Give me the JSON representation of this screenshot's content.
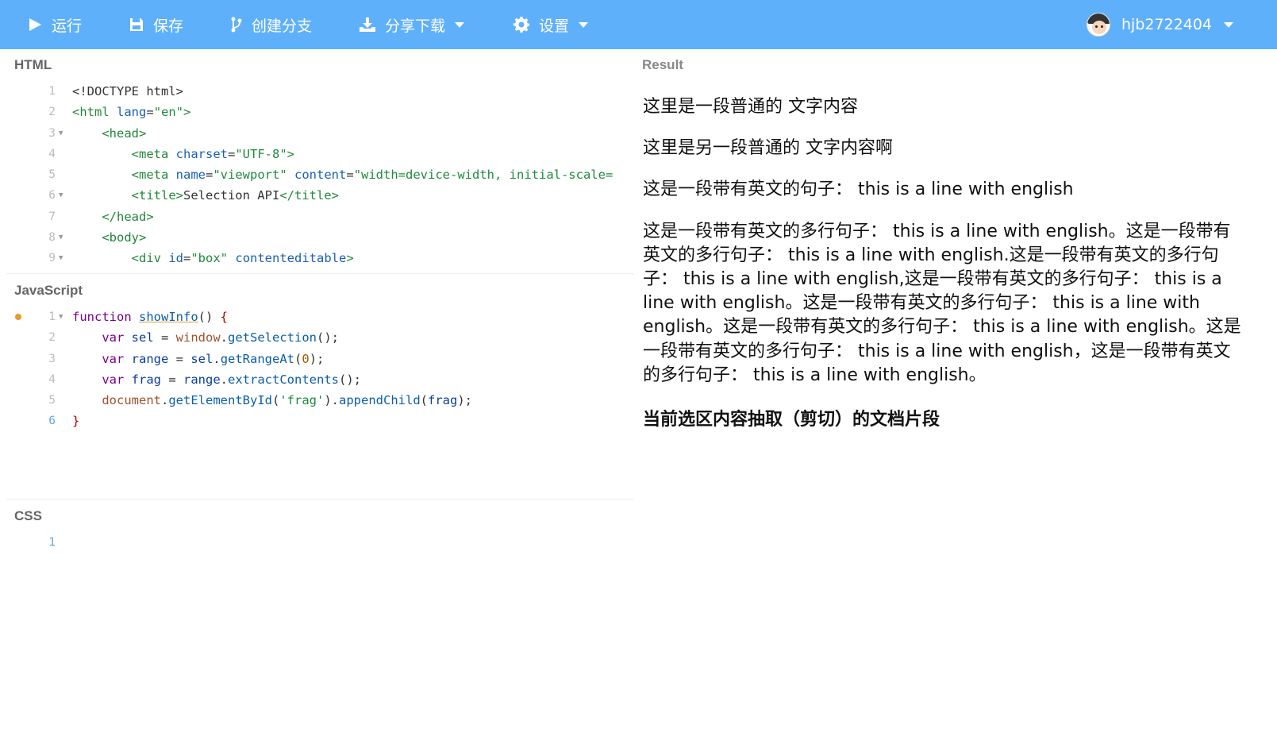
{
  "toolbar": {
    "run": "运行",
    "save": "保存",
    "branch": "创建分支",
    "share": "分享下载",
    "settings": "设置",
    "username": "hjb2722404",
    "accent": "#5fb0fb"
  },
  "html_pane": {
    "title": "HTML",
    "lines": [
      {
        "n": "1",
        "fold": false
      },
      {
        "n": "2",
        "fold": false
      },
      {
        "n": "3",
        "fold": true
      },
      {
        "n": "4",
        "fold": false
      },
      {
        "n": "5",
        "fold": false
      },
      {
        "n": "6",
        "fold": true
      },
      {
        "n": "7",
        "fold": false
      },
      {
        "n": "8",
        "fold": true
      },
      {
        "n": "9",
        "fold": true
      }
    ]
  },
  "js_pane": {
    "title": "JavaScript",
    "lines": [
      {
        "n": "1"
      },
      {
        "n": "2"
      },
      {
        "n": "3"
      },
      {
        "n": "4"
      },
      {
        "n": "5"
      },
      {
        "n": "6"
      }
    ]
  },
  "css_pane": {
    "title": "CSS",
    "lines": [
      {
        "n": "1"
      }
    ]
  },
  "result": {
    "title": "Result",
    "p1": "这里是一段普通的 文字内容",
    "p2": "这里是另一段普通的 文字内容啊",
    "p3": "这是一段带有英文的句子： this is a line with english",
    "p4": "这是一段带有英文的多行句子： this is a line with english。这是一段带有英文的多行句子： this is a line with english.这是一段带有英文的多行句子： this is a line with english,这是一段带有英文的多行句子： this is a line with english。这是一段带有英文的多行句子： this is a line with english。这是一段带有英文的多行句子： this is a line with english。这是一段带有英文的多行句子： this is a line with english，这是一段带有英文的多行句子： this is a line with english。",
    "heading": "当前选区内容抽取（剪切）的文档片段"
  }
}
